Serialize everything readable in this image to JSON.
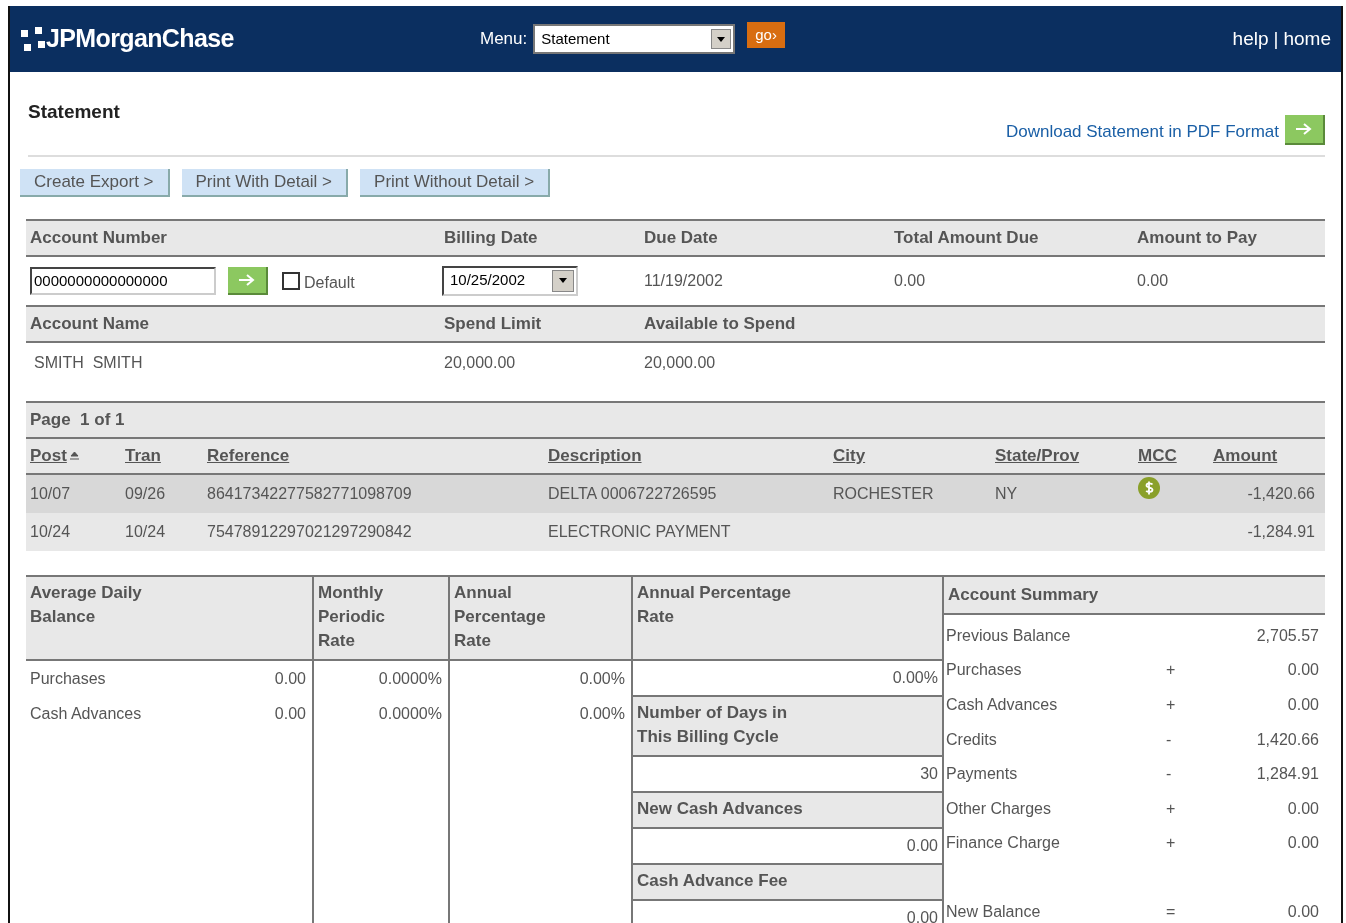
{
  "header": {
    "logo": "JPMorganChase",
    "menu_label": "Menu:",
    "menu_value": "Statement",
    "go_button": "go›",
    "links": [
      "help",
      "home"
    ],
    "link_separator": "|"
  },
  "page_title": "Statement",
  "download_link": "Download Statement in PDF Format",
  "action_buttons": [
    "Create Export >",
    "Print With Detail >",
    "Print Without Detail >"
  ],
  "account": {
    "columns": [
      "Account Number",
      "Billing Date",
      "Due Date",
      "Total Amount Due",
      "Amount to Pay"
    ],
    "account_number": "0000000000000000",
    "default_label": "Default",
    "default_checked": false,
    "billing_date": "10/25/2002",
    "due_date": "11/19/2002",
    "total_amount_due": "0.00",
    "amount_to_pay": "0.00",
    "columns_2": [
      "Account Name",
      "Spend Limit",
      "Available to Spend"
    ],
    "account_name": "SMITH  SMITH",
    "spend_limit": "20,000.00",
    "available_to_spend": "20,000.00"
  },
  "transactions": {
    "page": "Page  1 of 1",
    "columns": [
      "Post",
      "Tran",
      "Reference",
      "Description",
      "City",
      "State/Prov",
      "MCC",
      "Amount"
    ],
    "rows": [
      {
        "post": "10/07",
        "tran": "09/26",
        "reference": "86417342277582771098709",
        "description": "DELTA 0006722726595",
        "city": "ROCHESTER",
        "state": "NY",
        "mcc_icon": true,
        "amount": "-1,420.66"
      },
      {
        "post": "10/24",
        "tran": "10/24",
        "reference": "75478912297021297290842",
        "description": "ELECTRONIC PAYMENT",
        "city": "",
        "state": "",
        "mcc_icon": false,
        "amount": "-1,284.91"
      }
    ]
  },
  "rates": {
    "headers": [
      "Average Daily Balance",
      "Monthly Periodic Rate",
      "Annual Percentage Rate"
    ],
    "rows": [
      {
        "label": "Purchases",
        "balance": "0.00",
        "monthly": "0.0000%",
        "annual": "0.00%"
      },
      {
        "label": "Cash Advances",
        "balance": "0.00",
        "monthly": "0.0000%",
        "annual": "0.00%"
      }
    ]
  },
  "details": [
    {
      "label": "Annual Percentage Rate",
      "value": "0.00%"
    },
    {
      "label": "Number of Days in This Billing Cycle",
      "value": "30"
    },
    {
      "label": "New Cash Advances",
      "value": "0.00"
    },
    {
      "label": "Cash Advance Fee",
      "value": "0.00"
    }
  ],
  "summary": {
    "title": "Account Summary",
    "rows": [
      {
        "label": "Previous Balance",
        "sign": "",
        "value": "2,705.57"
      },
      {
        "label": "Purchases",
        "sign": "+",
        "value": "0.00"
      },
      {
        "label": "Cash Advances",
        "sign": "+",
        "value": "0.00"
      },
      {
        "label": "Credits",
        "sign": "-",
        "value": "1,420.66"
      },
      {
        "label": "Payments",
        "sign": "-",
        "value": "1,284.91"
      },
      {
        "label": "Other Charges",
        "sign": "+",
        "value": "0.00"
      },
      {
        "label": "Finance Charge",
        "sign": "+",
        "value": "0.00"
      },
      {
        "label": "New Balance",
        "sign": "=",
        "value": "0.00"
      }
    ]
  }
}
